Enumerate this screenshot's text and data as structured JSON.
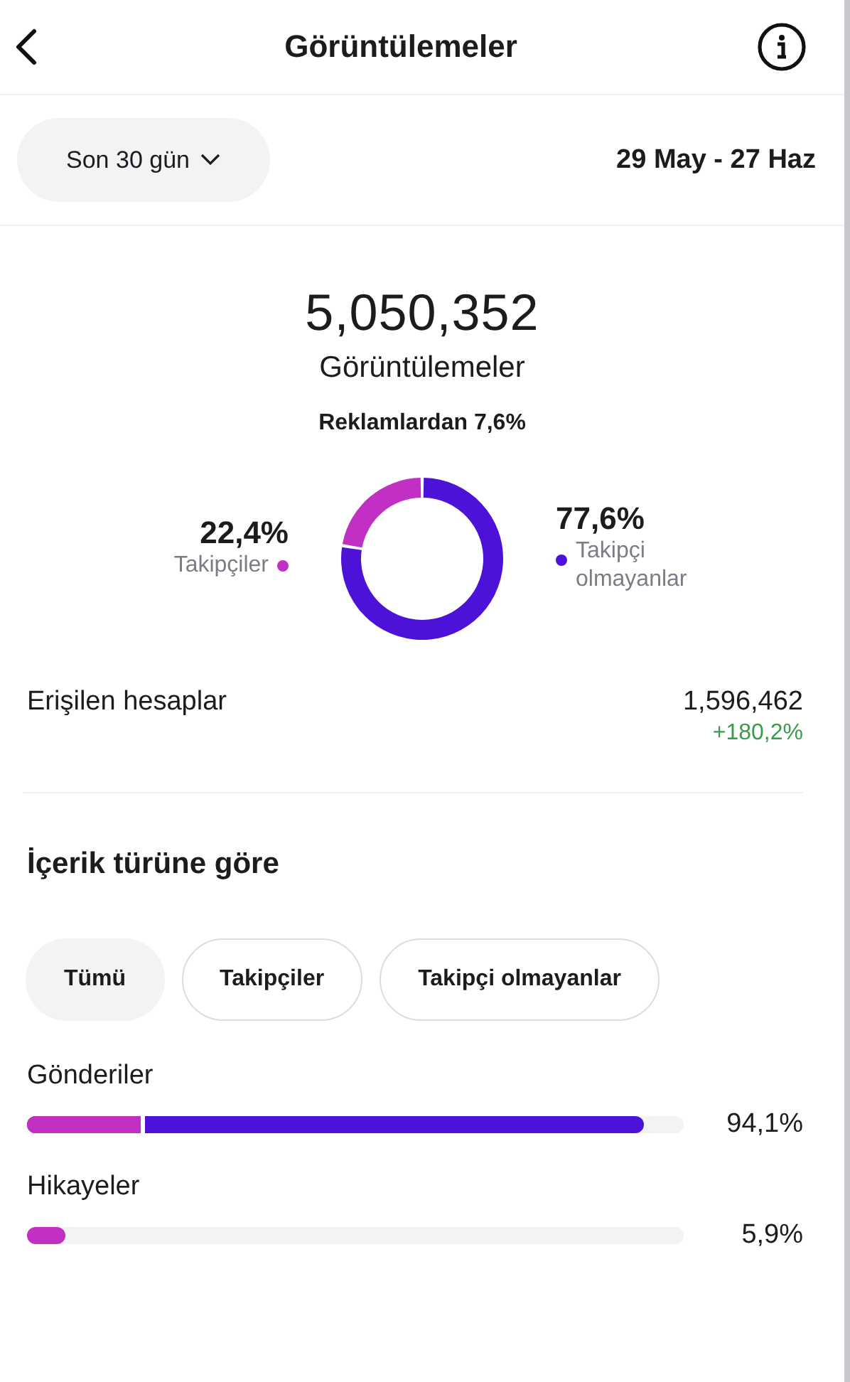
{
  "header": {
    "title": "Görüntülemeler"
  },
  "filter": {
    "period": "Son 30 gün",
    "date_range": "29 May - 27 Haz"
  },
  "summary": {
    "total": "5,050,352",
    "label": "Görüntülemeler",
    "ads_note": "Reklamlardan 7,6%"
  },
  "breakdown": [
    {
      "percent": "22,4%",
      "label": "Takipçiler",
      "color": "#c22fc3"
    },
    {
      "percent": "77,6%",
      "label": "Takipçi olmayanlar",
      "color": "#4c12d8"
    }
  ],
  "reach": {
    "label": "Erişilen hesaplar",
    "value": "1,596,462",
    "change": "+180,2%"
  },
  "content_section": {
    "title": "İçerik türüne göre"
  },
  "chips": [
    {
      "label": "Tümü",
      "selected": true
    },
    {
      "label": "Takipçiler",
      "selected": false
    },
    {
      "label": "Takipçi olmayanlar",
      "selected": false
    }
  ],
  "content_rows": [
    {
      "label": "Gönderiler",
      "percent": "94,1%",
      "segments": [
        {
          "color": "#c22fc3",
          "level": 0.18
        },
        {
          "color": "#4c12d8",
          "level": 0.94
        }
      ]
    },
    {
      "label": "Hikayeler",
      "percent": "5,9%",
      "segments": [
        {
          "color": "#c22fc3",
          "level": 0.059
        }
      ]
    }
  ]
}
